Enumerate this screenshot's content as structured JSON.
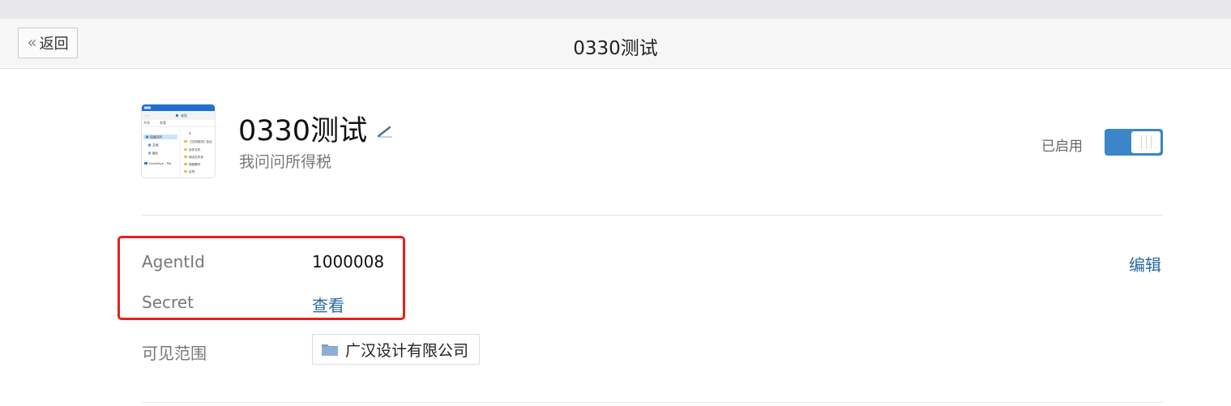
{
  "nav": {
    "back_label": "返回",
    "title": "0330测试"
  },
  "app": {
    "name": "0330测试",
    "description": "我问问所得税",
    "status_label": "已启用",
    "enabled": true
  },
  "icon_preview": {
    "sidebar_items": [
      "快速访问",
      "文档",
      "图片",
      "OneDrive - Per"
    ],
    "toolbar_items": [
      "共享",
      "查看"
    ],
    "path": "桌面",
    "file_items": [
      "【文档相关】会议",
      "协作文件",
      "测试文件夹",
      "视频素材",
      "合同"
    ]
  },
  "fields": {
    "agentid_label": "AgentId",
    "agentid_value": "1000008",
    "secret_label": "Secret",
    "secret_action": "查看",
    "scope_label": "可见范围",
    "scope_value": "广汉设计有限公司",
    "edit_label": "编辑"
  },
  "colors": {
    "accent": "#3b86c8",
    "link": "#2a6a9e",
    "highlight": "#e8201c"
  }
}
